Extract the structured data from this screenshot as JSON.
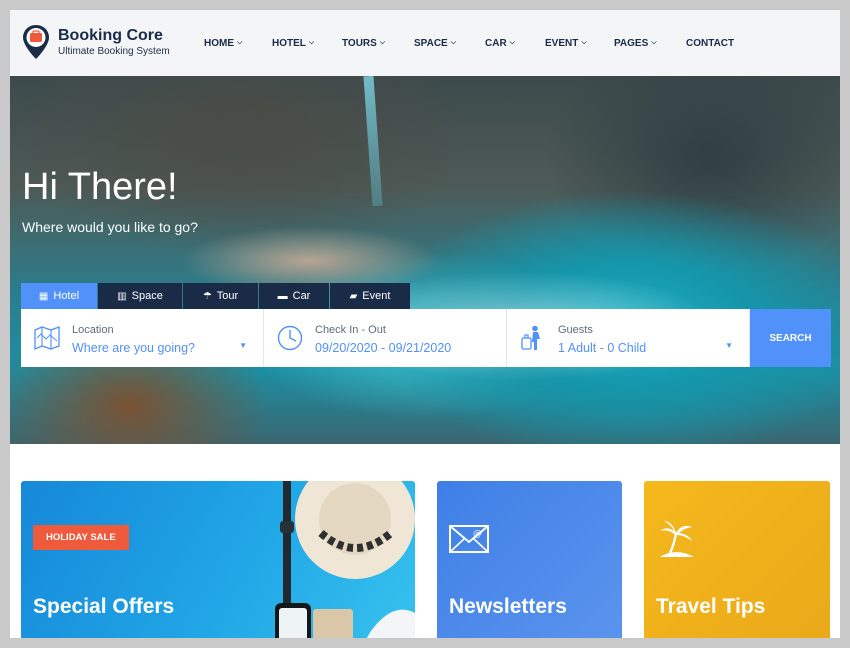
{
  "brand": {
    "title": "Booking Core",
    "subtitle": "Ultimate Booking System",
    "pin_color": "#f05a3c",
    "navy": "#1a2b48",
    "accent": "#5191fa"
  },
  "nav": {
    "items": [
      {
        "label": "HOME",
        "dropdown": true
      },
      {
        "label": "HOTEL",
        "dropdown": true
      },
      {
        "label": "TOURS",
        "dropdown": true
      },
      {
        "label": "SPACE",
        "dropdown": true
      },
      {
        "label": "CAR",
        "dropdown": true
      },
      {
        "label": "EVENT",
        "dropdown": true
      },
      {
        "label": "PAGES",
        "dropdown": true
      },
      {
        "label": "CONTACT",
        "dropdown": false
      }
    ]
  },
  "hero": {
    "title": "Hi There!",
    "subtitle": "Where would you like to go?"
  },
  "tabs": [
    {
      "label": "Hotel",
      "icon": "building-icon",
      "active": true
    },
    {
      "label": "Space",
      "icon": "office-icon",
      "active": false
    },
    {
      "label": "Tour",
      "icon": "beach-icon",
      "active": false
    },
    {
      "label": "Car",
      "icon": "car-icon",
      "active": false
    },
    {
      "label": "Event",
      "icon": "ticket-icon",
      "active": false
    }
  ],
  "search": {
    "location": {
      "label": "Location",
      "value": "Where are you going?",
      "icon": "map-icon"
    },
    "dates": {
      "label": "Check In - Out",
      "value": "09/20/2020 - 09/21/2020",
      "icon": "clock-icon"
    },
    "guests": {
      "label": "Guests",
      "value": "1 Adult - 0 Child",
      "icon": "traveler-icon"
    },
    "button": "SEARCH"
  },
  "cards": [
    {
      "badge": "HOLIDAY SALE",
      "title": "Special Offers",
      "color": "#1ea0e0"
    },
    {
      "title": "Newsletters",
      "icon": "envelope-icon",
      "color": "#4a86e8"
    },
    {
      "title": "Travel Tips",
      "icon": "palm-island-icon",
      "color": "#f0b41c"
    }
  ]
}
